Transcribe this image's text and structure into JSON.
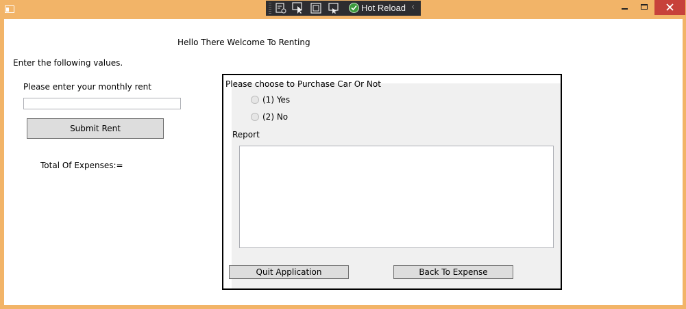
{
  "devtools": {
    "hot_reload_label": "Hot Reload",
    "icons": [
      "live-visual-tree-icon",
      "select-element-icon",
      "display-layout-adorners-icon",
      "track-focused-element-icon",
      "hot-reload-check-icon",
      "collapse-toolbar-icon"
    ]
  },
  "window_controls": {
    "close_color": "#c7413a",
    "frame_color": "#f2b468"
  },
  "main": {
    "welcome": "Hello There Welcome To Renting",
    "instruction": "Enter the following values.",
    "rent_prompt": "Please enter your monthly rent",
    "rent_value": "",
    "submit_label": "Submit Rent",
    "total_label": "Total Of Expenses:="
  },
  "panel": {
    "title": "Please choose to Purchase Car Or Not",
    "options": [
      {
        "label": "(1) Yes",
        "checked": false
      },
      {
        "label": "(2) No",
        "checked": false
      }
    ],
    "report_label": "Report",
    "report_value": "",
    "quit_label": "Quit Application",
    "back_label": "Back To Expense"
  }
}
